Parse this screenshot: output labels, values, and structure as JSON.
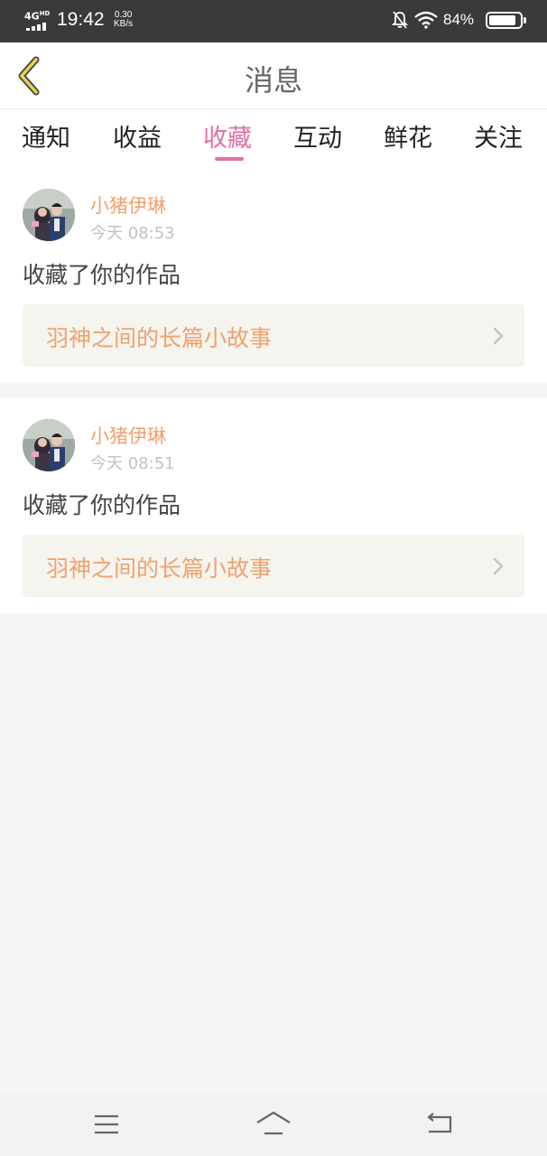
{
  "status_bar": {
    "network": "4G",
    "network_sup": "HD",
    "time": "19:42",
    "speed_value": "0.30",
    "speed_unit": "KB/s",
    "battery": "84%",
    "battery_level": 0.84
  },
  "header": {
    "title": "消息",
    "back_icon": "chevron-left-icon",
    "accent": "#e8d44d"
  },
  "tabs": [
    {
      "label": "通知",
      "active": false
    },
    {
      "label": "收益",
      "active": false
    },
    {
      "label": "收藏",
      "active": true
    },
    {
      "label": "互动",
      "active": false
    },
    {
      "label": "鲜花",
      "active": false
    },
    {
      "label": "关注",
      "active": false
    }
  ],
  "messages": [
    {
      "user": "小猪伊琳",
      "time": "今天 08:53",
      "action": "收藏了你的作品",
      "work_title": "羽神之间的长篇小故事"
    },
    {
      "user": "小猪伊琳",
      "time": "今天 08:51",
      "action": "收藏了你的作品",
      "work_title": "羽神之间的长篇小故事"
    }
  ],
  "colors": {
    "active_tab": "#e46ea7",
    "username": "#f0a26e",
    "work_title": "#f0a26e",
    "card_link_bg": "#f5f4ee"
  },
  "nav": {
    "menu_icon": "menu-icon",
    "home_icon": "home-icon",
    "back_icon": "back-icon"
  }
}
